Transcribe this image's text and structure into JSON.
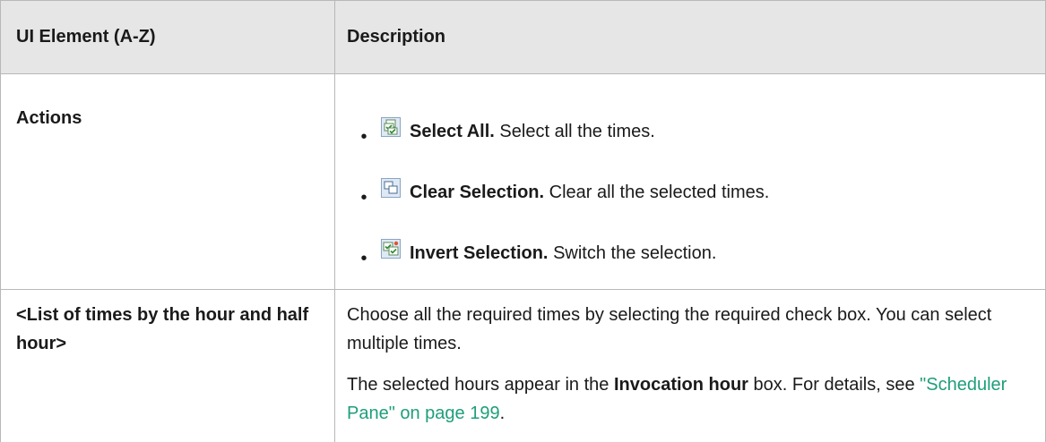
{
  "header": {
    "col1": "UI Element (A-Z)",
    "col2": "Description"
  },
  "rows": [
    {
      "element": "Actions",
      "actions": [
        {
          "icon": "select-all-icon",
          "label": "Select All.",
          "text": "Select all the times."
        },
        {
          "icon": "clear-selection-icon",
          "label": "Clear Selection.",
          "text": "Clear all the selected times."
        },
        {
          "icon": "invert-selection-icon",
          "label": "Invert Selection.",
          "text": "Switch the selection."
        }
      ]
    },
    {
      "element": "<List of times by the hour and half hour>",
      "p1": "Choose all the required times by selecting the required check box. You can select multiple times.",
      "p2_prefix": "The selected hours appear in the ",
      "p2_bold": "Invocation hour",
      "p2_mid": " box. For details, see ",
      "p2_link": "\"Scheduler Pane\" on page 199",
      "p2_suffix": "."
    }
  ],
  "colors": {
    "header_bg": "#e6e6e6",
    "border": "#b8b8b8",
    "link": "#1e9e7a"
  }
}
